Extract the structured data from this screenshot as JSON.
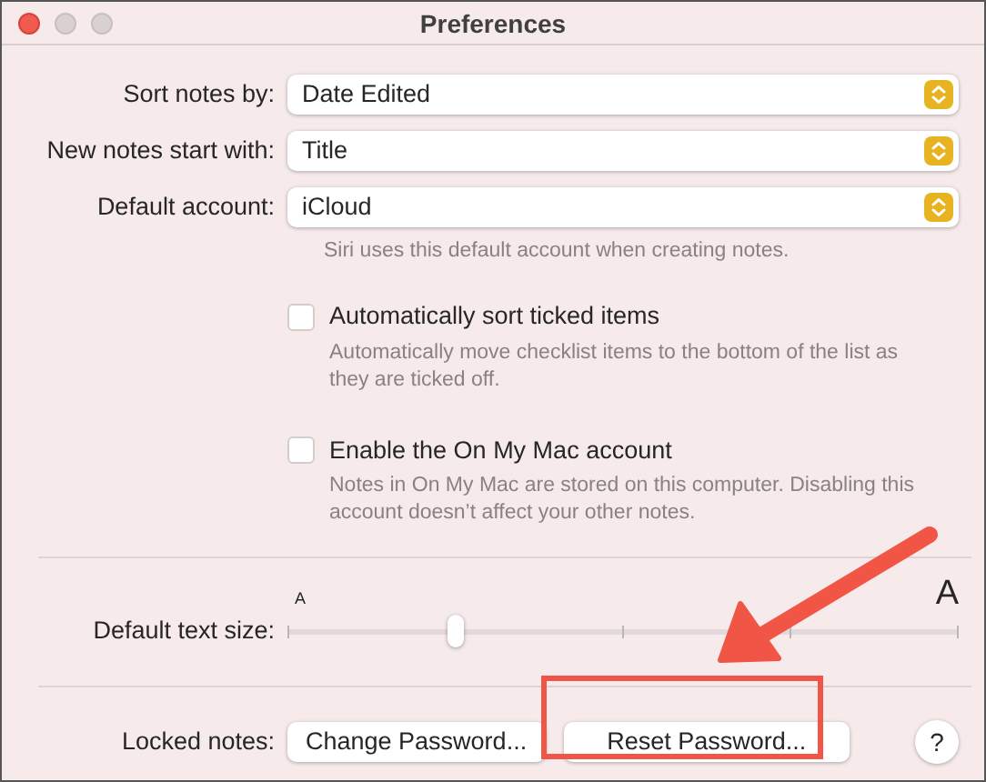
{
  "window": {
    "title": "Preferences",
    "buttons": [
      {
        "kind": "close"
      },
      {
        "kind": "minimize"
      },
      {
        "kind": "zoom"
      }
    ]
  },
  "popups": [
    {
      "label": "Sort notes by:",
      "value": "Date Edited"
    },
    {
      "label": "New notes start with:",
      "value": "Title"
    },
    {
      "label": "Default account:",
      "value": "iCloud",
      "hint": "Siri uses this default account when creating notes."
    }
  ],
  "checkboxes": [
    {
      "label": "Automatically sort ticked items",
      "checked": false,
      "description": "Automatically move checklist items to the bottom of the list as they are ticked off."
    },
    {
      "label": "Enable the On My Mac account",
      "checked": false,
      "description": "Notes in On My Mac are stored on this computer. Disabling this account doesn’t affect your other notes."
    }
  ],
  "text_size": {
    "label": "Default text size:",
    "min_label": "A",
    "max_label": "A",
    "level": 0.25
  },
  "locked_notes": {
    "label": "Locked notes:",
    "buttons": [
      "Change Password...",
      "Reset Password..."
    ],
    "help": "?"
  }
}
